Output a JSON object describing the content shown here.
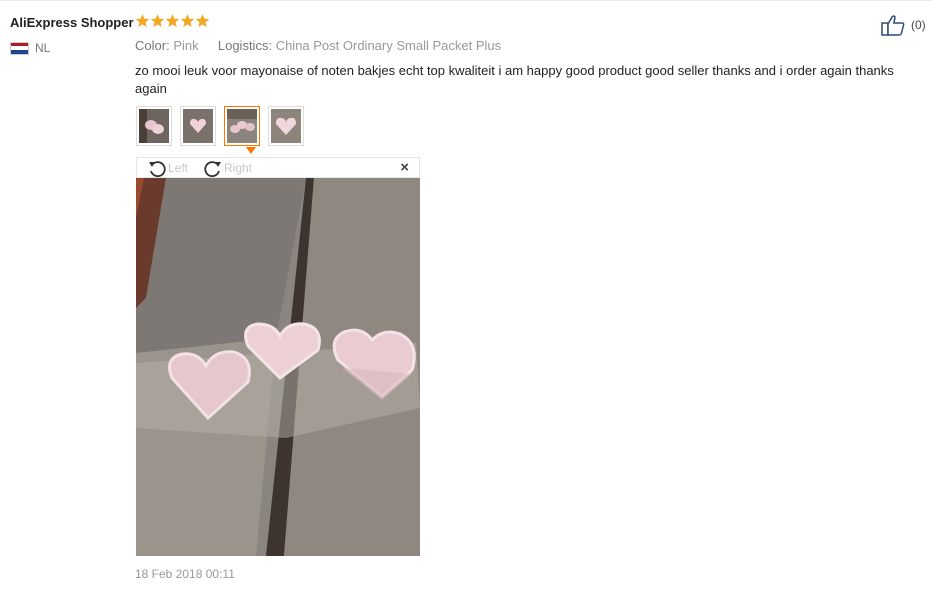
{
  "review": {
    "user_name": "AliExpress Shopper",
    "rating": 5,
    "country_code": "NL",
    "color_label": "Color:",
    "color_value": "Pink",
    "logistics_label": "Logistics:",
    "logistics_value": "China Post Ordinary Small Packet Plus",
    "text": "zo mooi leuk voor mayonaise of noten bakjes echt top kwaliteit i am happy good product good seller thanks and i order again thanks again",
    "date": "18 Feb 2018 00:11",
    "like_count": "(0)"
  },
  "viewer": {
    "rotate_left_label": "Left",
    "rotate_right_label": "Right",
    "close_label": "×",
    "selected_index": 2,
    "photo_count": 4
  },
  "colors": {
    "star": "#f5a623",
    "accent": "#ff7300",
    "flag_red": "#ae1c28",
    "flag_white": "#ffffff",
    "flag_blue": "#21468b",
    "bowl_pink": "#e9c9cf"
  },
  "icons": {
    "star": "star-icon",
    "like": "thumbs-up-icon",
    "rotate_left": "rotate-left-icon",
    "rotate_right": "rotate-right-icon",
    "close": "close-icon"
  }
}
